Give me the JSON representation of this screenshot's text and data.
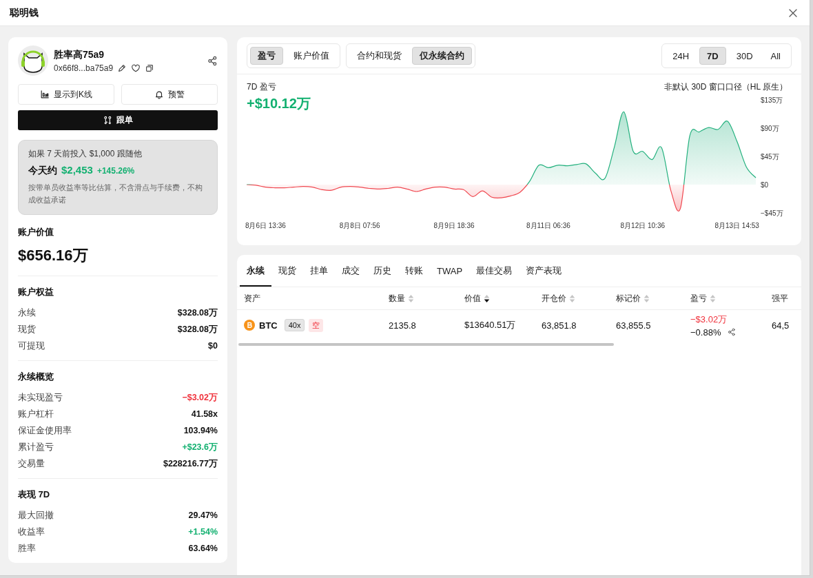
{
  "window": {
    "title": "聪明钱"
  },
  "profile": {
    "name": "胜率高75a9",
    "address": "0x66f8...ba75a9"
  },
  "actions": [
    {
      "label": "显示到K线",
      "kind": "chart"
    },
    {
      "label": "预警",
      "kind": "bell"
    }
  ],
  "follow_button": {
    "label": "跟单"
  },
  "simulation": {
    "intro": "如果 7 天前投入 $1,000 跟随他",
    "today_label": "今天约",
    "today_value": "$2,453",
    "change": "+145.26%",
    "note": "按带单员收益率等比估算，不含滑点与手续费，不构成收益承诺"
  },
  "account_value": {
    "label": "账户价值",
    "value": "$656.16万"
  },
  "sections": [
    {
      "title": "账户权益",
      "rows": [
        {
          "label": "永续",
          "value": "$328.08万",
          "color": "#111111"
        },
        {
          "label": "现货",
          "value": "$328.08万",
          "color": "#111111"
        },
        {
          "label": "可提现",
          "value": "$0",
          "color": "#111111"
        }
      ]
    },
    {
      "title": "永续概览",
      "rows": [
        {
          "label": "未实现盈亏",
          "value": "−$3.02万",
          "color": "#f0323c"
        },
        {
          "label": "账户杠杆",
          "value": "41.58x",
          "color": "#111111"
        },
        {
          "label": "保证金使用率",
          "value": "103.94%",
          "color": "#111111"
        },
        {
          "label": "累计盈亏",
          "value": "+$23.6万",
          "color": "#12b070"
        },
        {
          "label": "交易量",
          "value": "$228216.77万",
          "color": "#111111"
        }
      ]
    },
    {
      "title": "表现 7D",
      "rows": [
        {
          "label": "最大回撤",
          "value": "29.47%",
          "color": "#111111"
        },
        {
          "label": "收益率",
          "value": "+1.54%",
          "color": "#12b070"
        },
        {
          "label": "胜率",
          "value": "63.64%",
          "color": "#111111"
        }
      ]
    }
  ],
  "pnl_chart": {
    "view_toggle": [
      {
        "label": "盈亏",
        "selected": true
      },
      {
        "label": "账户价值",
        "selected": false
      }
    ],
    "market_toggle": [
      {
        "label": "合约和现货",
        "selected": false
      },
      {
        "label": "仅永续合约",
        "selected": true
      }
    ],
    "range_tabs": [
      {
        "label": "24H",
        "selected": false
      },
      {
        "label": "7D",
        "selected": true
      },
      {
        "label": "30D",
        "selected": false
      },
      {
        "label": "All",
        "selected": false
      }
    ],
    "title": "7D 盈亏",
    "total": "+$10.12万",
    "note": "非默认 30D 窗口口径（HL 原生）",
    "chart_data": {
      "type": "area",
      "categories": [
        null,
        null,
        "8月6日 13:36",
        null,
        null,
        null,
        null,
        null,
        null,
        null,
        null,
        null,
        "8月8日 07:56",
        null,
        null,
        null,
        null,
        null,
        null,
        null,
        null,
        null,
        "8月9日 18:36",
        null,
        null,
        null,
        null,
        null,
        null,
        null,
        null,
        null,
        "8月11日 06:36",
        null,
        null,
        null,
        null,
        null,
        null,
        null,
        null,
        null,
        "8月12日 10:36",
        null,
        null,
        null,
        null,
        null,
        null,
        null,
        null,
        null,
        "8月13日 14:53",
        null,
        null
      ],
      "series": [
        {
          "color": "#22b07d",
          "values": [
            0,
            -1,
            -4,
            -5,
            -5,
            -4,
            -3,
            -4,
            -8,
            -9,
            -4,
            -3,
            -4,
            -6,
            -7,
            -6,
            -4,
            -7,
            -11,
            -7,
            -4,
            -4,
            -7,
            -8,
            -19,
            -10,
            -20,
            -21,
            -18,
            -12,
            5,
            31,
            27,
            31,
            30,
            32,
            33,
            18,
            10,
            60,
            116,
            53,
            53,
            40,
            59,
            -10,
            -38,
            78,
            84,
            91,
            88,
            101,
            69,
            28,
            11
          ]
        }
      ],
      "ylim": [
        -45,
        135
      ],
      "yticks": [
        {
          "value": 135,
          "label": "$135万"
        },
        {
          "value": 90,
          "label": "$90万"
        },
        {
          "value": 45,
          "label": "$45万"
        },
        {
          "value": 0,
          "label": "$0"
        },
        {
          "value": -45,
          "label": "−$45万"
        }
      ]
    }
  },
  "positions": {
    "tabs": [
      {
        "label": "永续",
        "selected": true
      },
      {
        "label": "现货",
        "selected": false
      },
      {
        "label": "挂单",
        "selected": false
      },
      {
        "label": "成交",
        "selected": false
      },
      {
        "label": "历史",
        "selected": false
      },
      {
        "label": "转账",
        "selected": false
      },
      {
        "label": "TWAP",
        "selected": false
      },
      {
        "label": "最佳交易",
        "selected": false
      },
      {
        "label": "资产表现",
        "selected": false
      }
    ],
    "columns": [
      {
        "label": "资产",
        "sortable": false
      },
      {
        "label": "数量",
        "sortable": true,
        "descending": false
      },
      {
        "label": "价值",
        "sortable": true,
        "descending": true
      },
      {
        "label": "开仓价",
        "sortable": true,
        "descending": false
      },
      {
        "label": "标记价",
        "sortable": true,
        "descending": false
      },
      {
        "label": "盈亏",
        "sortable": true,
        "descending": false
      },
      {
        "label": "强平",
        "sortable": false
      }
    ],
    "rows": [
      {
        "asset": "BTC",
        "leverage": "40x",
        "side": "空",
        "size": "2135.8",
        "value": "$13640.51万",
        "entry_price": "63,851.8",
        "mark_price": "63,855.5",
        "pnl": "−$3.02万",
        "pnl_percent": "−0.88%",
        "loss": true,
        "liquidation_price": "64,5"
      }
    ]
  }
}
